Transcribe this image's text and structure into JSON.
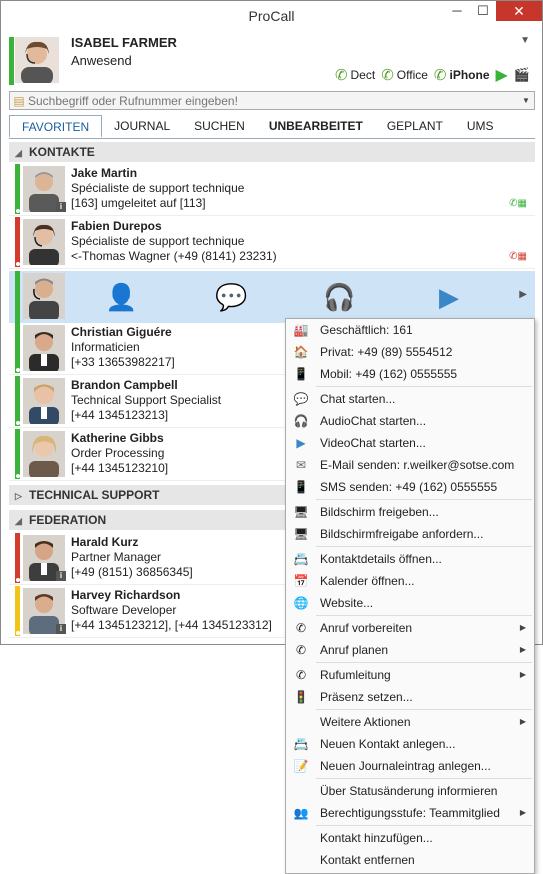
{
  "window": {
    "title": "ProCall",
    "minimize": "─",
    "maximize": "☐",
    "close": "✕"
  },
  "user": {
    "name": "ISABEL FARMER",
    "status": "Anwesend"
  },
  "devices": [
    {
      "label": "Dect",
      "bold": false
    },
    {
      "label": "Office",
      "bold": false
    },
    {
      "label": "iPhone",
      "bold": true
    }
  ],
  "search": {
    "placeholder": "Suchbegriff oder Rufnummer eingeben!"
  },
  "tabs": [
    {
      "label": "FAVORITEN",
      "active": true,
      "bold": false
    },
    {
      "label": "JOURNAL",
      "active": false,
      "bold": false
    },
    {
      "label": "SUCHEN",
      "active": false,
      "bold": false
    },
    {
      "label": "UNBEARBEITET",
      "active": false,
      "bold": true
    },
    {
      "label": "GEPLANT",
      "active": false,
      "bold": false
    },
    {
      "label": "UMS",
      "active": false,
      "bold": false
    }
  ],
  "groups": {
    "kontakte": "KONTAKTE",
    "technical_support": "TECHNICAL SUPPORT",
    "federation": "FEDERATION"
  },
  "contacts": [
    {
      "name": "Jake Martin",
      "line2": "Spécialiste de support technique",
      "line3": "[163] umgeleitet auf [113]",
      "color": "#3bb33b"
    },
    {
      "name": "Fabien Durepos",
      "line2": "Spécialiste de support technique",
      "line3": "<-Thomas Wagner (+49 (8141) 23231)",
      "color": "#d33c2c"
    },
    {
      "name": "Christian Giguére",
      "line2": "Informaticien",
      "line3": "[+33 13653982217]",
      "color": "#3bb33b"
    },
    {
      "name": "Brandon Campbell",
      "line2": "Technical Support Specialist",
      "line3": "[+44 1345123213]",
      "color": "#3bb33b"
    },
    {
      "name": "Katherine Gibbs",
      "line2": "Order Processing",
      "line3": "[+44 1345123210]",
      "color": "#3bb33b"
    },
    {
      "name": "Harald Kurz",
      "line2": "Partner Manager",
      "line3": "[+49 (8151) 36856345]",
      "color": "#d33c2c"
    },
    {
      "name": "Harvey Richardson",
      "line2": "Software Developer",
      "line3": "[+44 1345123212], [+44 1345123312]",
      "color": "#f2c418"
    }
  ],
  "menu": {
    "business": "Geschäftlich: 161",
    "private": "Privat: +49 (89) 5554512",
    "mobile": "Mobil: +49 (162) 0555555",
    "chat": "Chat starten...",
    "audiochat": "AudioChat starten...",
    "videochat": "VideoChat starten...",
    "email": "E-Mail senden: r.weilker@sotse.com",
    "sms": "SMS senden: +49 (162) 0555555",
    "screen_share": "Bildschirm freigeben...",
    "screen_request": "Bildschirmfreigabe anfordern...",
    "details": "Kontaktdetails öffnen...",
    "calendar": "Kalender öffnen...",
    "website": "Website...",
    "prepare_call": "Anruf vorbereiten",
    "plan_call": "Anruf planen",
    "forwarding": "Rufumleitung",
    "presence": "Präsenz setzen...",
    "more_actions": "Weitere Aktionen",
    "new_contact": "Neuen Kontakt anlegen...",
    "new_journal": "Neuen Journaleintrag anlegen...",
    "notify_status": "Über Statusänderung informieren",
    "permission": "Berechtigungsstufe: Teammitglied",
    "add_contact": "Kontakt hinzufügen...",
    "remove_contact": "Kontakt entfernen"
  },
  "colors": {
    "accent": "#3a86c8",
    "selected_row": "#cfe3f7",
    "available": "#3bb33b",
    "busy": "#d33c2c",
    "away": "#f2c418"
  }
}
